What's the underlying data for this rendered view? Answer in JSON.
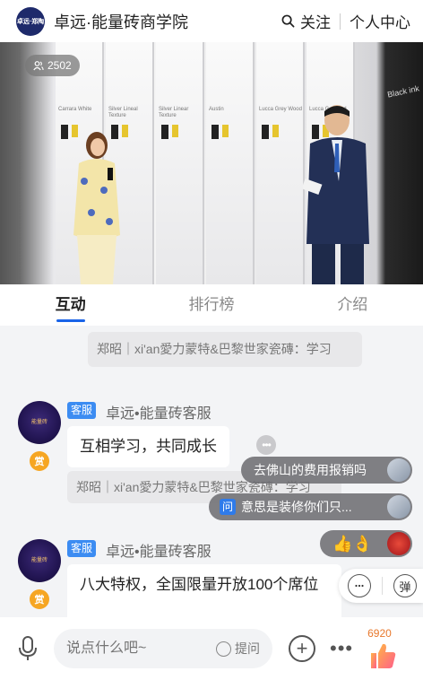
{
  "header": {
    "logo_text": "卓远·郑陶",
    "title": "卓远·能量砖商学院",
    "follow_label": "关注",
    "profile_label": "个人中心"
  },
  "video": {
    "viewer_count": "2502",
    "panels": [
      "Carrara White",
      "Silver Lineal Texture",
      "Silver Linear Texture",
      "Austin",
      "Lucca Grey Wood",
      "Lucca Gr Wood"
    ],
    "right_wall_label": "Black ink"
  },
  "tabs": [
    {
      "label": "互动",
      "active": true
    },
    {
      "label": "排行榜",
      "active": false
    },
    {
      "label": "介绍",
      "active": false
    }
  ],
  "chat": {
    "system_message": "郑昭｜xi'an愛力蒙特&巴黎世家瓷磚：学习",
    "messages": [
      {
        "badge": "客服",
        "sender": "卓远•能量砖客服",
        "text": "互相学习，共同成长",
        "quote": "郑昭｜xi'an愛力蒙特&巴黎世家瓷磚：学习",
        "reward_label": "赏"
      },
      {
        "badge": "客服",
        "sender": "卓远•能量砖客服",
        "text": "八大特权，全国限量开放100个席位",
        "reward_label": "赏"
      }
    ],
    "more_label": "•••"
  },
  "floating": {
    "msg1": "去佛山的费用报销吗",
    "msg2_tag": "问",
    "msg2": "意思是装修你们只...",
    "emoji": "👍👌"
  },
  "side_actions": {
    "comment_icon": "comment-icon",
    "danmaku_label": "弹"
  },
  "bottom": {
    "placeholder": "说点什么吧~",
    "ask_label": "提问",
    "like_count": "6920"
  },
  "colors": {
    "accent": "#1a64e8",
    "badge": "#3c8cf2",
    "reward": "#f6a623",
    "like": "#e8782c"
  }
}
